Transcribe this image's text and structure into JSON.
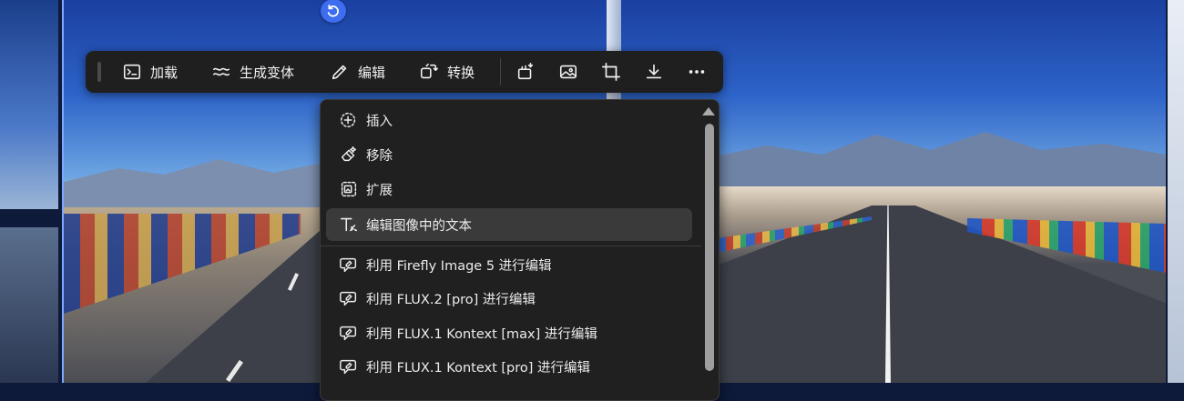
{
  "toolbar": {
    "buttons": [
      {
        "label": "加载",
        "icon": "terminal-icon"
      },
      {
        "label": "生成变体",
        "icon": "wave-icon"
      },
      {
        "label": "编辑",
        "icon": "pencil-icon"
      },
      {
        "label": "转换",
        "icon": "transform-icon"
      }
    ],
    "icon_buttons": [
      "insert-object-icon",
      "image-icon",
      "crop-icon",
      "download-icon",
      "more-icon"
    ]
  },
  "undo": {
    "icon": "undo-icon"
  },
  "menu": {
    "items": [
      {
        "label": "插入",
        "icon": "insert-icon"
      },
      {
        "label": "移除",
        "icon": "eraser-icon"
      },
      {
        "label": "扩展",
        "icon": "expand-icon"
      },
      {
        "label": "编辑图像中的文本",
        "icon": "text-edit-icon",
        "active": true
      },
      {
        "label": "利用 Firefly Image 5 进行编辑",
        "icon": "chat-edit-icon"
      },
      {
        "label": "利用 FLUX.2 [pro] 进行编辑",
        "icon": "chat-edit-icon"
      },
      {
        "label": "利用 FLUX.1 Kontext [max] 进行编辑",
        "icon": "chat-edit-icon"
      },
      {
        "label": "利用 FLUX.1 Kontext [pro] 进行编辑",
        "icon": "chat-edit-icon"
      }
    ]
  },
  "colors": {
    "toolbar_bg": "#1f1f1f",
    "menu_bg": "#202020",
    "accent": "#3e6df0",
    "active_item": "#3a3a3a"
  }
}
